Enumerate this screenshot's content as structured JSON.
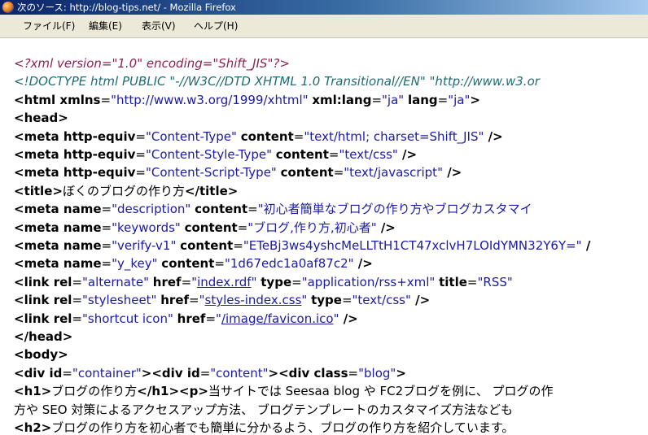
{
  "window": {
    "title": "次のソース: http://blog-tips.net/ - Mozilla Firefox",
    "icon": "firefox-icon"
  },
  "menu": [
    {
      "name": "menu-file",
      "label": "ファイル(F)"
    },
    {
      "name": "menu-edit",
      "label": "編集(E)"
    },
    {
      "name": "menu-view",
      "label": "表示(V)"
    },
    {
      "name": "menu-help",
      "label": "ヘルプ(H)"
    }
  ],
  "source_lines": [
    [
      {
        "cls": "c-pi",
        "text": "<?xml version=\"1.0\" encoding=\"Shift_JIS\"?>"
      }
    ],
    [
      {
        "cls": "c-dt",
        "text": "<!DOCTYPE html PUBLIC \"-//W3C//DTD XHTML 1.0 Transitional//EN\" \"http://www.w3.or"
      }
    ],
    [
      {
        "cls": "c-tag",
        "text": "<html "
      },
      {
        "cls": "c-attr",
        "text": "xmlns"
      },
      {
        "cls": "c-text",
        "text": "="
      },
      {
        "cls": "c-val",
        "text": "\"http://www.w3.org/1999/xhtml\""
      },
      {
        "cls": "c-text",
        "text": " "
      },
      {
        "cls": "c-attr",
        "text": "xml:lang"
      },
      {
        "cls": "c-text",
        "text": "="
      },
      {
        "cls": "c-val",
        "text": "\"ja\""
      },
      {
        "cls": "c-text",
        "text": " "
      },
      {
        "cls": "c-attr",
        "text": "lang"
      },
      {
        "cls": "c-text",
        "text": "="
      },
      {
        "cls": "c-val",
        "text": "\"ja\""
      },
      {
        "cls": "c-tag",
        "text": ">"
      }
    ],
    [
      {
        "cls": "c-tag",
        "text": "<head>"
      }
    ],
    [
      {
        "cls": "c-tag",
        "text": "<meta "
      },
      {
        "cls": "c-attr",
        "text": "http-equiv"
      },
      {
        "cls": "c-text",
        "text": "="
      },
      {
        "cls": "c-val",
        "text": "\"Content-Type\""
      },
      {
        "cls": "c-text",
        "text": " "
      },
      {
        "cls": "c-attr",
        "text": "content"
      },
      {
        "cls": "c-text",
        "text": "="
      },
      {
        "cls": "c-val",
        "text": "\"text/html; charset=Shift_JIS\""
      },
      {
        "cls": "c-tag",
        "text": " />"
      }
    ],
    [
      {
        "cls": "c-tag",
        "text": "<meta "
      },
      {
        "cls": "c-attr",
        "text": "http-equiv"
      },
      {
        "cls": "c-text",
        "text": "="
      },
      {
        "cls": "c-val",
        "text": "\"Content-Style-Type\""
      },
      {
        "cls": "c-text",
        "text": " "
      },
      {
        "cls": "c-attr",
        "text": "content"
      },
      {
        "cls": "c-text",
        "text": "="
      },
      {
        "cls": "c-val",
        "text": "\"text/css\""
      },
      {
        "cls": "c-tag",
        "text": " />"
      }
    ],
    [
      {
        "cls": "c-tag",
        "text": "<meta "
      },
      {
        "cls": "c-attr",
        "text": "http-equiv"
      },
      {
        "cls": "c-text",
        "text": "="
      },
      {
        "cls": "c-val",
        "text": "\"Content-Script-Type\""
      },
      {
        "cls": "c-text",
        "text": " "
      },
      {
        "cls": "c-attr",
        "text": "content"
      },
      {
        "cls": "c-text",
        "text": "="
      },
      {
        "cls": "c-val",
        "text": "\"text/javascript\""
      },
      {
        "cls": "c-tag",
        "text": " />"
      }
    ],
    [
      {
        "cls": "c-tag",
        "text": "<title>"
      },
      {
        "cls": "c-text",
        "text": "ぼくのブログの作り方"
      },
      {
        "cls": "c-tag",
        "text": "</title>"
      }
    ],
    [
      {
        "cls": "c-tag",
        "text": "<meta "
      },
      {
        "cls": "c-attr",
        "text": "name"
      },
      {
        "cls": "c-text",
        "text": "="
      },
      {
        "cls": "c-val",
        "text": "\"description\""
      },
      {
        "cls": "c-text",
        "text": " "
      },
      {
        "cls": "c-attr",
        "text": "content"
      },
      {
        "cls": "c-text",
        "text": "="
      },
      {
        "cls": "c-val",
        "text": "\"初心者簡単なブログの作り方やブログカスタマイ"
      }
    ],
    [
      {
        "cls": "c-tag",
        "text": "<meta "
      },
      {
        "cls": "c-attr",
        "text": "name"
      },
      {
        "cls": "c-text",
        "text": "="
      },
      {
        "cls": "c-val",
        "text": "\"keywords\""
      },
      {
        "cls": "c-text",
        "text": " "
      },
      {
        "cls": "c-attr",
        "text": "content"
      },
      {
        "cls": "c-text",
        "text": "="
      },
      {
        "cls": "c-val",
        "text": "\"ブログ,作り方,初心者\""
      },
      {
        "cls": "c-tag",
        "text": " />"
      }
    ],
    [
      {
        "cls": "c-tag",
        "text": "<meta "
      },
      {
        "cls": "c-attr",
        "text": "name"
      },
      {
        "cls": "c-text",
        "text": "="
      },
      {
        "cls": "c-val",
        "text": "\"verify-v1\""
      },
      {
        "cls": "c-text",
        "text": " "
      },
      {
        "cls": "c-attr",
        "text": "content"
      },
      {
        "cls": "c-text",
        "text": "="
      },
      {
        "cls": "c-val",
        "text": "\"ETeBj3ws4yshcMeLLTtH1CT47xclvH7LOIdYMN32Y6Y=\""
      },
      {
        "cls": "c-tag",
        "text": " /"
      }
    ],
    [
      {
        "cls": "c-tag",
        "text": "<meta "
      },
      {
        "cls": "c-attr",
        "text": "name"
      },
      {
        "cls": "c-text",
        "text": "="
      },
      {
        "cls": "c-val",
        "text": "\"y_key\""
      },
      {
        "cls": "c-text",
        "text": " "
      },
      {
        "cls": "c-attr",
        "text": "content"
      },
      {
        "cls": "c-text",
        "text": "="
      },
      {
        "cls": "c-val",
        "text": "\"1d67edc1a0af87c2\""
      },
      {
        "cls": "c-tag",
        "text": " />"
      }
    ],
    [
      {
        "cls": "c-tag",
        "text": "<link "
      },
      {
        "cls": "c-attr",
        "text": "rel"
      },
      {
        "cls": "c-text",
        "text": "="
      },
      {
        "cls": "c-val",
        "text": "\"alternate\""
      },
      {
        "cls": "c-text",
        "text": " "
      },
      {
        "cls": "c-attr",
        "text": "href"
      },
      {
        "cls": "c-text",
        "text": "="
      },
      {
        "cls": "c-val",
        "text": "\""
      },
      {
        "cls": "c-link",
        "text": "index.rdf"
      },
      {
        "cls": "c-val",
        "text": "\""
      },
      {
        "cls": "c-text",
        "text": " "
      },
      {
        "cls": "c-attr",
        "text": "type"
      },
      {
        "cls": "c-text",
        "text": "="
      },
      {
        "cls": "c-val",
        "text": "\"application/rss+xml\""
      },
      {
        "cls": "c-text",
        "text": " "
      },
      {
        "cls": "c-attr",
        "text": "title"
      },
      {
        "cls": "c-text",
        "text": "="
      },
      {
        "cls": "c-val",
        "text": "\"RSS\""
      }
    ],
    [
      {
        "cls": "c-tag",
        "text": "<link "
      },
      {
        "cls": "c-attr",
        "text": "rel"
      },
      {
        "cls": "c-text",
        "text": "="
      },
      {
        "cls": "c-val",
        "text": "\"stylesheet\""
      },
      {
        "cls": "c-text",
        "text": " "
      },
      {
        "cls": "c-attr",
        "text": "href"
      },
      {
        "cls": "c-text",
        "text": "="
      },
      {
        "cls": "c-val",
        "text": "\""
      },
      {
        "cls": "c-link",
        "text": "styles-index.css"
      },
      {
        "cls": "c-val",
        "text": "\""
      },
      {
        "cls": "c-text",
        "text": " "
      },
      {
        "cls": "c-attr",
        "text": "type"
      },
      {
        "cls": "c-text",
        "text": "="
      },
      {
        "cls": "c-val",
        "text": "\"text/css\""
      },
      {
        "cls": "c-tag",
        "text": " />"
      }
    ],
    [
      {
        "cls": "c-tag",
        "text": "<link "
      },
      {
        "cls": "c-attr",
        "text": "rel"
      },
      {
        "cls": "c-text",
        "text": "="
      },
      {
        "cls": "c-val",
        "text": "\"shortcut icon\""
      },
      {
        "cls": "c-text",
        "text": " "
      },
      {
        "cls": "c-attr",
        "text": "href"
      },
      {
        "cls": "c-text",
        "text": "="
      },
      {
        "cls": "c-val",
        "text": "\""
      },
      {
        "cls": "c-link",
        "text": "/image/favicon.ico"
      },
      {
        "cls": "c-val",
        "text": "\""
      },
      {
        "cls": "c-tag",
        "text": " />"
      }
    ],
    [
      {
        "cls": "c-tag",
        "text": "</head>"
      }
    ],
    [
      {
        "cls": "c-tag",
        "text": "<body>"
      }
    ],
    [
      {
        "cls": "c-tag",
        "text": "<div "
      },
      {
        "cls": "c-attr",
        "text": "id"
      },
      {
        "cls": "c-text",
        "text": "="
      },
      {
        "cls": "c-val",
        "text": "\"container\""
      },
      {
        "cls": "c-tag",
        "text": "><div "
      },
      {
        "cls": "c-attr",
        "text": "id"
      },
      {
        "cls": "c-text",
        "text": "="
      },
      {
        "cls": "c-val",
        "text": "\"content\""
      },
      {
        "cls": "c-tag",
        "text": "><div "
      },
      {
        "cls": "c-attr",
        "text": "class"
      },
      {
        "cls": "c-text",
        "text": "="
      },
      {
        "cls": "c-val",
        "text": "\"blog\""
      },
      {
        "cls": "c-tag",
        "text": ">"
      }
    ],
    [
      {
        "cls": "c-tag",
        "text": "<h1>"
      },
      {
        "cls": "c-text",
        "text": "ブログの作り方"
      },
      {
        "cls": "c-tag",
        "text": "</h1><p>"
      },
      {
        "cls": "c-text",
        "text": "当サイトでは Seesaa blog や FC2ブログを例に、 プログの作"
      }
    ],
    [
      {
        "cls": "c-text",
        "text": "方や SEO 対策によるアクセスアップ方法、 ブログテンプレートのカスタマイズ方法なども"
      }
    ],
    [
      {
        "cls": "c-tag",
        "text": "<h2>"
      },
      {
        "cls": "c-text",
        "text": "ブログの作り方を初心者でも簡単に分かるよう、ブログの作り方を紹介しています。"
      }
    ]
  ]
}
